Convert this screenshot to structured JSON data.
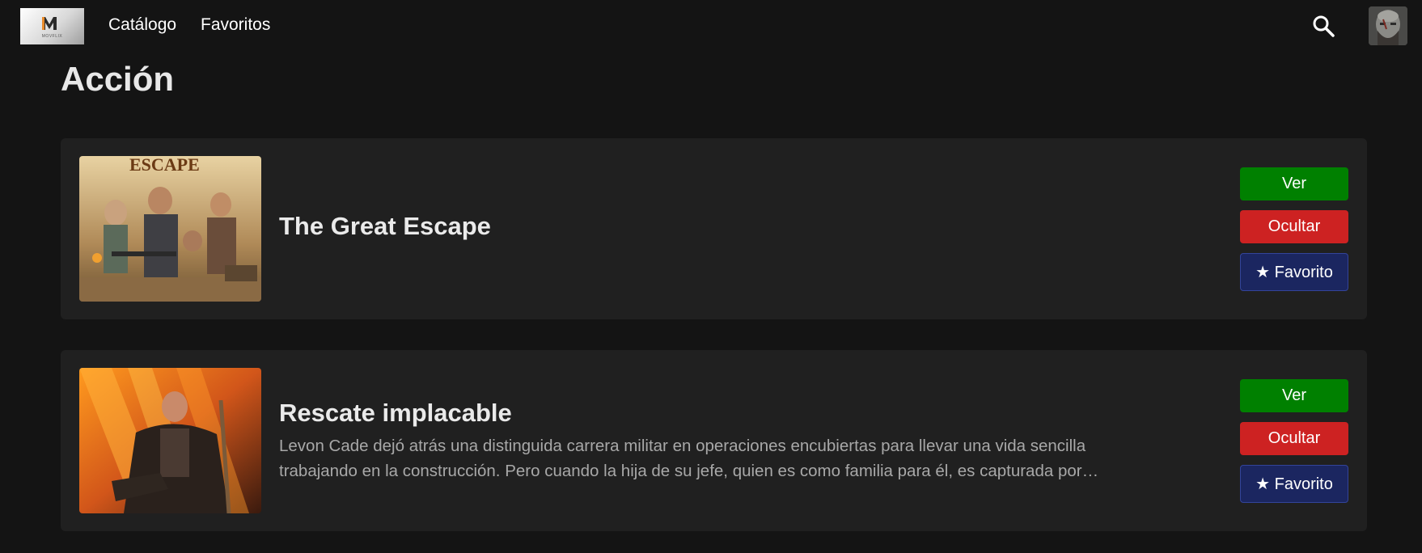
{
  "brand": {
    "logo_caption": "MOVFLIX"
  },
  "nav": {
    "catalogo": "Catálogo",
    "favoritos": "Favoritos"
  },
  "section": {
    "title": "Acción"
  },
  "movies": [
    {
      "title": "The Great Escape",
      "description": "",
      "ver_label": "Ver",
      "ocultar_label": "Ocultar",
      "favorito_label": "★ Favorito"
    },
    {
      "title": "Rescate implacable",
      "description": "Levon Cade dejó atrás una distinguida carrera militar en operaciones encubiertas para llevar una vida sencilla trabajando en la construcción. Pero cuando la hija de su jefe, quien es como familia para él, es capturada por…",
      "ver_label": "Ver",
      "ocultar_label": "Ocultar",
      "favorito_label": "★ Favorito"
    }
  ],
  "colors": {
    "background": "#141414",
    "card": "#202020",
    "ver": "#008000",
    "ocultar": "#cd2222",
    "favorito": "#1b2660"
  },
  "icons": {
    "search": "search-icon"
  }
}
